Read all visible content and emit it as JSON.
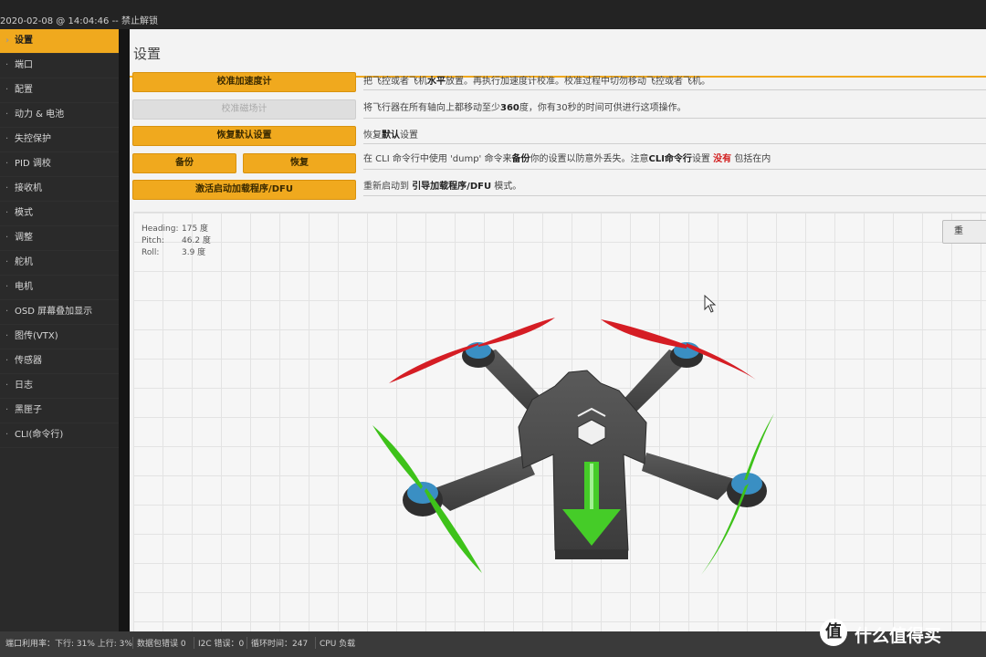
{
  "window": {
    "title_fragment": "2020-02-08 @ 14:04:46 -- 禁止解锁"
  },
  "sidebar": {
    "items": [
      {
        "label": "设置",
        "icon": "wrench-icon",
        "active": true
      },
      {
        "label": "端口",
        "icon": "plug-icon"
      },
      {
        "label": "配置",
        "icon": "gear-icon"
      },
      {
        "label": "动力 & 电池",
        "icon": "battery-icon"
      },
      {
        "label": "失控保护",
        "icon": "shield-icon"
      },
      {
        "label": "PID 调校",
        "icon": "sliders-icon"
      },
      {
        "label": "接收机",
        "icon": "antenna-icon"
      },
      {
        "label": "模式",
        "icon": "switch-icon"
      },
      {
        "label": "调整",
        "icon": "adjust-icon"
      },
      {
        "label": "舵机",
        "icon": "servo-icon"
      },
      {
        "label": "电机",
        "icon": "motor-icon"
      },
      {
        "label": "OSD 屏幕叠加显示",
        "icon": "screen-icon"
      },
      {
        "label": "图传(VTX)",
        "icon": "vtx-icon"
      },
      {
        "label": "传感器",
        "icon": "sensor-icon"
      },
      {
        "label": "日志",
        "icon": "log-icon"
      },
      {
        "label": "黑匣子",
        "icon": "blackbox-icon"
      },
      {
        "label": "CLI(命令行)",
        "icon": "terminal-icon"
      }
    ]
  },
  "page": {
    "title": "设置",
    "buttons": {
      "calibrate_acc": "校准加速度计",
      "calibrate_mag": "校准磁场计",
      "reset_defaults": "恢复默认设置",
      "backup": "备份",
      "restore": "恢复",
      "dfu": "激活启动加载程序/DFU"
    },
    "descriptions": {
      "acc_pre": "把飞控或者飞机",
      "acc_bold": "水平",
      "acc_post": "放置。再执行加速度计校准。校准过程中切勿移动飞控或者飞机。",
      "mag_pre": "将飞行器在所有轴向上都移动至少",
      "mag_bold": "360",
      "mag_post": "度，你有30秒的时间可供进行这项操作。",
      "reset_pre": "恢复",
      "reset_bold": "默认",
      "reset_post": "设置",
      "backup_a": "在 CLI 命令行中使用 'dump' 命令来",
      "backup_b": "备份",
      "backup_c": "你的设置以防意外丢失。注意",
      "backup_d": "CLI命令行",
      "backup_e": "设置",
      "backup_f": "没有",
      "backup_g": " 包括在内",
      "dfu_pre": "重新启动到 ",
      "dfu_bold": "引导加载程序/DFU",
      "dfu_post": " 模式。"
    },
    "attitude": {
      "heading_label": "Heading:",
      "heading_value": "175 度",
      "pitch_label": "Pitch:",
      "pitch_value": "46.2 度",
      "roll_label": "Roll:",
      "roll_value": "3.9 度"
    },
    "reset_view_label": "重"
  },
  "status_bar": {
    "port": "端口利用率：下行: 31% 上行: 3%",
    "packet_error": "数据包错误 0",
    "i2c_error": "I2C 错误：0",
    "cycle_time": "循环时间：247",
    "cpu": "CPU 负载"
  },
  "watermark": {
    "logo_glyph": "值",
    "text": "什么值得买"
  },
  "colors": {
    "accent": "#f0a91e",
    "prop_red": "#d51d24",
    "prop_green": "#3ec21a",
    "frame": "#4a4a4a"
  }
}
